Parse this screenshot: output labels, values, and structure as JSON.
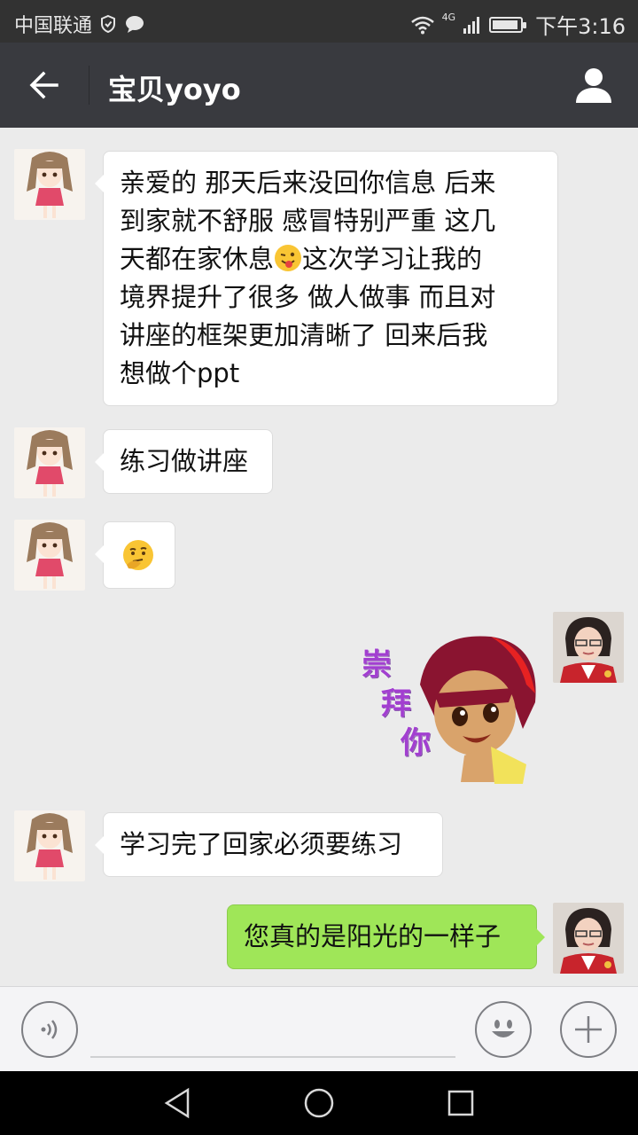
{
  "status_bar": {
    "carrier": "中国联通",
    "network": "4G",
    "time": "下午3:16"
  },
  "header": {
    "title": "宝贝yoyo",
    "back_icon": "arrow-left-icon",
    "profile_icon": "person-icon"
  },
  "messages": [
    {
      "sender": "contact",
      "type": "text",
      "lines": [
        "亲爱的 那天后来没回你信息 后来",
        "到家就不舒服 感冒特别严重 这几",
        "天都在家休息",
        "这次学习让我的",
        "境界提升了很多 做人做事 而且对",
        "讲座的框架更加清晰了 回来后我",
        "想做个ppt"
      ],
      "inline_emoji": "winking-tongue-emoji"
    },
    {
      "sender": "contact",
      "type": "text",
      "text": "练习做讲座"
    },
    {
      "sender": "contact",
      "type": "emoji",
      "emoji": "thinking-face-emoji"
    },
    {
      "sender": "me",
      "type": "sticker",
      "sticker_text": [
        "崇",
        "拜",
        "你"
      ]
    },
    {
      "sender": "contact",
      "type": "text",
      "text": "学习完了回家必须要练习"
    },
    {
      "sender": "me",
      "type": "text",
      "text": "您真的是阳光的一样子"
    }
  ],
  "input_bar": {
    "voice_icon": "voice-icon",
    "emoji_icon": "smiley-icon",
    "more_icon": "plus-icon"
  },
  "nav_bar": {
    "back_icon": "triangle-back-icon",
    "home_icon": "circle-home-icon",
    "recents_icon": "square-recents-icon"
  },
  "colors": {
    "title_bar": "#393a3f",
    "status_bar": "#323232",
    "chat_background": "#ebebeb",
    "my_bubble": "#9fe658",
    "their_bubble": "#ffffff"
  }
}
